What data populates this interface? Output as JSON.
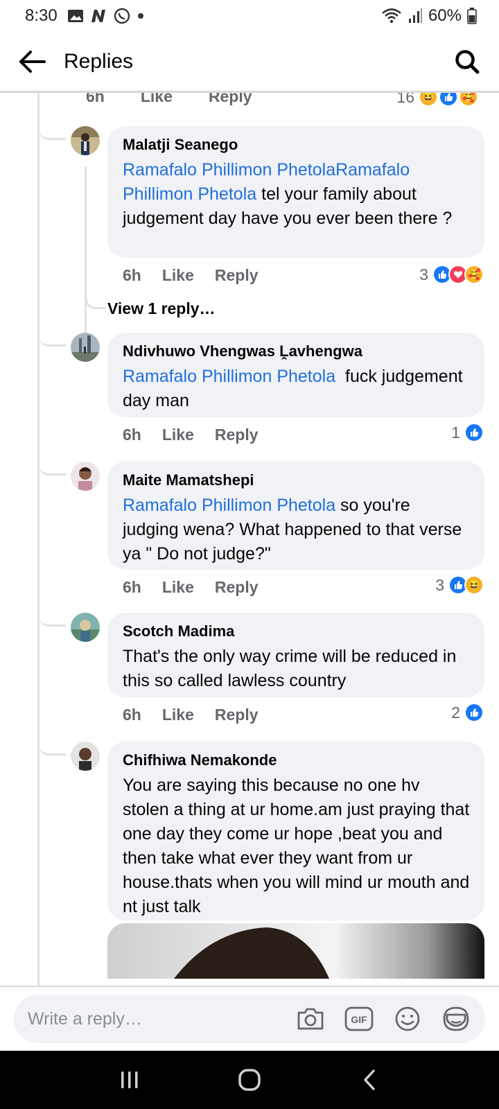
{
  "status_bar": {
    "time": "8:30",
    "battery": "60%",
    "icons": [
      "gallery-icon",
      "n-app-icon",
      "whatsapp-icon",
      "dot-icon",
      "wifi-icon",
      "signal-icon",
      "battery-icon"
    ]
  },
  "header": {
    "title": "Replies",
    "back_icon": "arrow-left-icon",
    "search_icon": "search-icon"
  },
  "partial_top": {
    "time": "6h",
    "like": "Like",
    "reply": "Reply",
    "count": "16"
  },
  "comments": [
    {
      "author": "Malatji Seanego",
      "mention": "Ramafalo Phillimon PhetolaRamafalo Phillimon Phetola",
      "text": " tel your family about judgement day have you ever been there ?",
      "time": "6h",
      "like": "Like",
      "reply": "Reply",
      "count": "3",
      "reactions": [
        "like",
        "love",
        "care"
      ]
    },
    {
      "author": "Ndivhuwo Vhengwas Ḽavhengwa",
      "mention": "Ramafalo Phillimon Phetola",
      "text": "  fuck judgement day man",
      "time": "6h",
      "like": "Like",
      "reply": "Reply",
      "count": "1",
      "reactions": [
        "like"
      ]
    },
    {
      "author": "Maite Mamatshepi",
      "mention": "Ramafalo Phillimon Phetola",
      "text": " so you're judging wena? What happened to that verse ya \" Do not judge?\"",
      "time": "6h",
      "like": "Like",
      "reply": "Reply",
      "count": "3",
      "reactions": [
        "like",
        "haha"
      ]
    },
    {
      "author": "Scotch Madima",
      "mention": "",
      "text": "That's the only way crime will be reduced in this so called lawless country",
      "time": "6h",
      "like": "Like",
      "reply": "Reply",
      "count": "2",
      "reactions": [
        "like"
      ]
    },
    {
      "author": "Chifhiwa Nemakonde",
      "mention": "",
      "text": "You are saying this because no one hv stolen a thing at ur home.am just praying that one day they come ur hope ,beat you and then take what ever they want from ur house.thats when you will mind ur mouth and nt just talk",
      "time": "",
      "like": "",
      "reply": "",
      "count": "",
      "reactions": []
    }
  ],
  "view_replies": "View 1 reply…",
  "composer": {
    "placeholder": "Write a reply…",
    "icons": [
      "camera-icon",
      "gif-icon",
      "emoji-icon",
      "sticker-icon"
    ]
  },
  "colors": {
    "mention": "#216fdb",
    "bubble": "#f0f2f5",
    "secondary_text": "#65676b",
    "like": "#1877f2",
    "love": "#f33e58"
  }
}
